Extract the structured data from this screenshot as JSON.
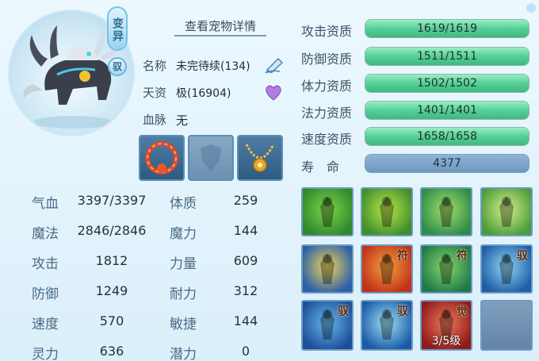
{
  "pet": {
    "variant_badge": "变异",
    "tamed_badge": "驭",
    "view_detail": "查看宠物详情",
    "name_label": "名称",
    "name_value": "未完待续(134)",
    "talent_label": "天资",
    "talent_value": "极(16904)",
    "bloodline_label": "血脉",
    "bloodline_value": "无"
  },
  "equipment": [
    {
      "name": "red-collar-icon",
      "state": "filled"
    },
    {
      "name": "empty-armor-slot-icon",
      "state": "empty"
    },
    {
      "name": "gold-necklace-icon",
      "state": "filled"
    }
  ],
  "stats_left": [
    {
      "label": "气血",
      "value": "3397/3397"
    },
    {
      "label": "魔法",
      "value": "2846/2846"
    },
    {
      "label": "攻击",
      "value": "1812"
    },
    {
      "label": "防御",
      "value": "1249"
    },
    {
      "label": "速度",
      "value": "570"
    },
    {
      "label": "灵力",
      "value": "636"
    }
  ],
  "stats_right": [
    {
      "label": "体质",
      "value": "259"
    },
    {
      "label": "魔力",
      "value": "144"
    },
    {
      "label": "力量",
      "value": "609"
    },
    {
      "label": "耐力",
      "value": "312"
    },
    {
      "label": "敏捷",
      "value": "144"
    },
    {
      "label": "潜力",
      "value": "0"
    }
  ],
  "aptitudes": [
    {
      "label": "攻击资质",
      "text": "1619/1619",
      "fill": 1.0
    },
    {
      "label": "防御资质",
      "text": "1511/1511",
      "fill": 1.0
    },
    {
      "label": "体力资质",
      "text": "1502/1502",
      "fill": 1.0
    },
    {
      "label": "法力资质",
      "text": "1401/1401",
      "fill": 1.0
    },
    {
      "label": "速度资质",
      "text": "1658/1658",
      "fill": 1.0
    }
  ],
  "lifespan": {
    "label": "寿　命",
    "value": "4377"
  },
  "skills": [
    {
      "name": "skill-green-statue-icon",
      "tag": "",
      "level": "",
      "colors": [
        "#2f8a2c",
        "#7fd44a"
      ]
    },
    {
      "name": "skill-green-shield-icon",
      "tag": "",
      "level": "",
      "colors": [
        "#3f8f2a",
        "#b9e64a"
      ]
    },
    {
      "name": "skill-boot-icon",
      "tag": "",
      "level": "",
      "colors": [
        "#2e8d4a",
        "#a6e06a"
      ]
    },
    {
      "name": "skill-heart-icon",
      "tag": "",
      "level": "",
      "colors": [
        "#4d9c3b",
        "#d6f08a"
      ]
    },
    {
      "name": "skill-sword-icon",
      "tag": "",
      "level": "",
      "colors": [
        "#2b5fa8",
        "#f1d65a"
      ]
    },
    {
      "name": "skill-red-figure-icon",
      "tag": "符",
      "level": "",
      "colors": [
        "#c1321a",
        "#f2a23c"
      ]
    },
    {
      "name": "skill-green-runner-icon",
      "tag": "符",
      "level": "",
      "colors": [
        "#1f7a4a",
        "#89d86a"
      ]
    },
    {
      "name": "skill-blue-shield-icon",
      "tag": "驭",
      "level": "",
      "colors": [
        "#1f5ea8",
        "#8fd6f2"
      ]
    },
    {
      "name": "skill-blue-guard-icon",
      "tag": "驭",
      "level": "",
      "colors": [
        "#1d4e9a",
        "#67b9ea"
      ]
    },
    {
      "name": "skill-blue-strike-icon",
      "tag": "驭",
      "level": "",
      "colors": [
        "#1a5aa8",
        "#9ee2f6"
      ]
    },
    {
      "name": "skill-red-awaken-icon",
      "tag": "觉",
      "level": "3/5级",
      "colors": [
        "#8f1a1a",
        "#f07a5a"
      ]
    },
    {
      "name": "skill-empty-slot",
      "tag": "",
      "level": "",
      "colors": [
        "#7f9fbe",
        "#6484a6"
      ]
    }
  ]
}
